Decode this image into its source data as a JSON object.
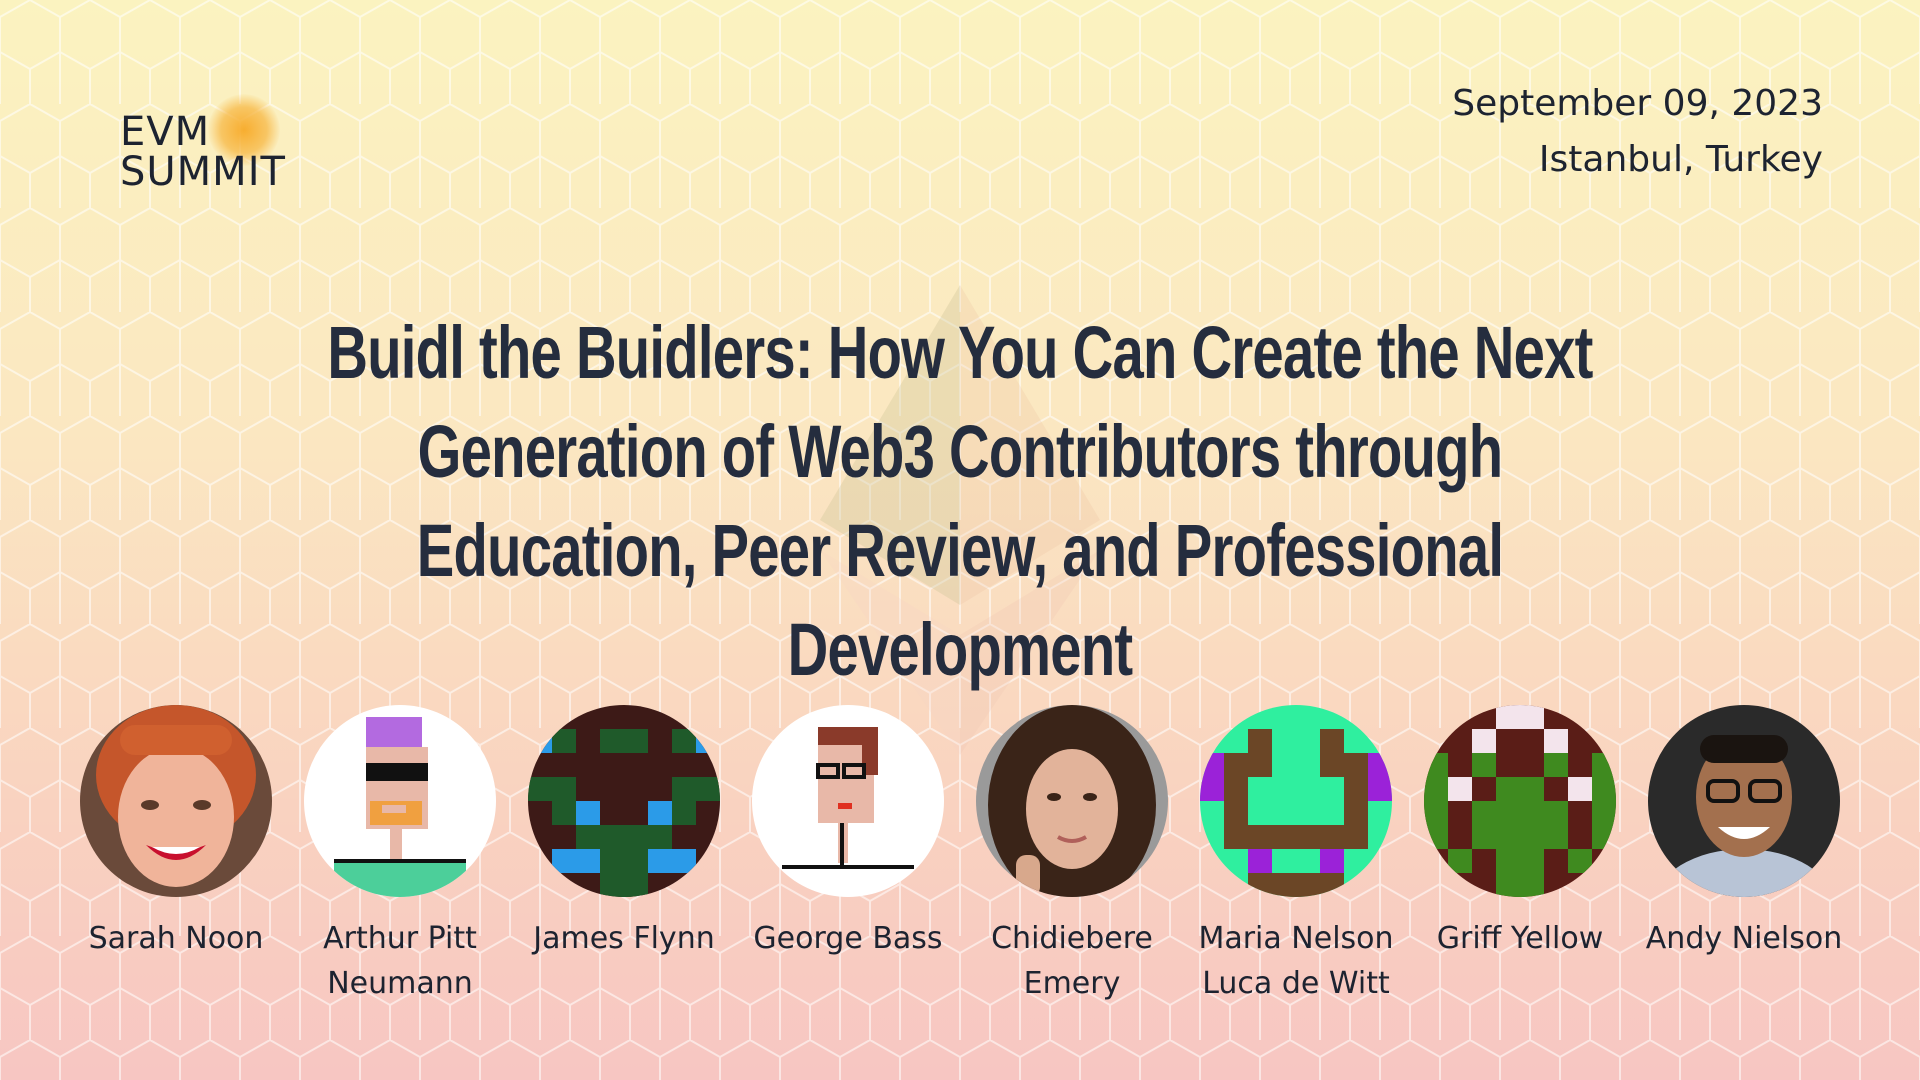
{
  "brand": {
    "line1": "EVM",
    "line2": "SUMMIT"
  },
  "event": {
    "date": "September 09, 2023",
    "location": "Istanbul, Turkey"
  },
  "title": "Buidl the Buidlers: How You Can Create the Next Generation of Web3 Contributors through Education, Peer Review, and Professional Development",
  "speakers": [
    {
      "name": "Sarah Noon",
      "avatar": "photo-red-hair"
    },
    {
      "name": "Arthur Pitt Neumann",
      "avatar": "pixel-punk-sunglasses"
    },
    {
      "name": "James Flynn",
      "avatar": "pixel-identicon-dark-green"
    },
    {
      "name": "George Bass",
      "avatar": "pixel-punk-glasses"
    },
    {
      "name": "Chidiebere Emery",
      "avatar": "photo-dark-hair"
    },
    {
      "name": "Maria Nelson Luca de Witt",
      "avatar": "pixel-identicon-mint-purple"
    },
    {
      "name": "Griff Yellow",
      "avatar": "pixel-identicon-green"
    },
    {
      "name": "Andy Nielson",
      "avatar": "photo-glasses"
    }
  ]
}
